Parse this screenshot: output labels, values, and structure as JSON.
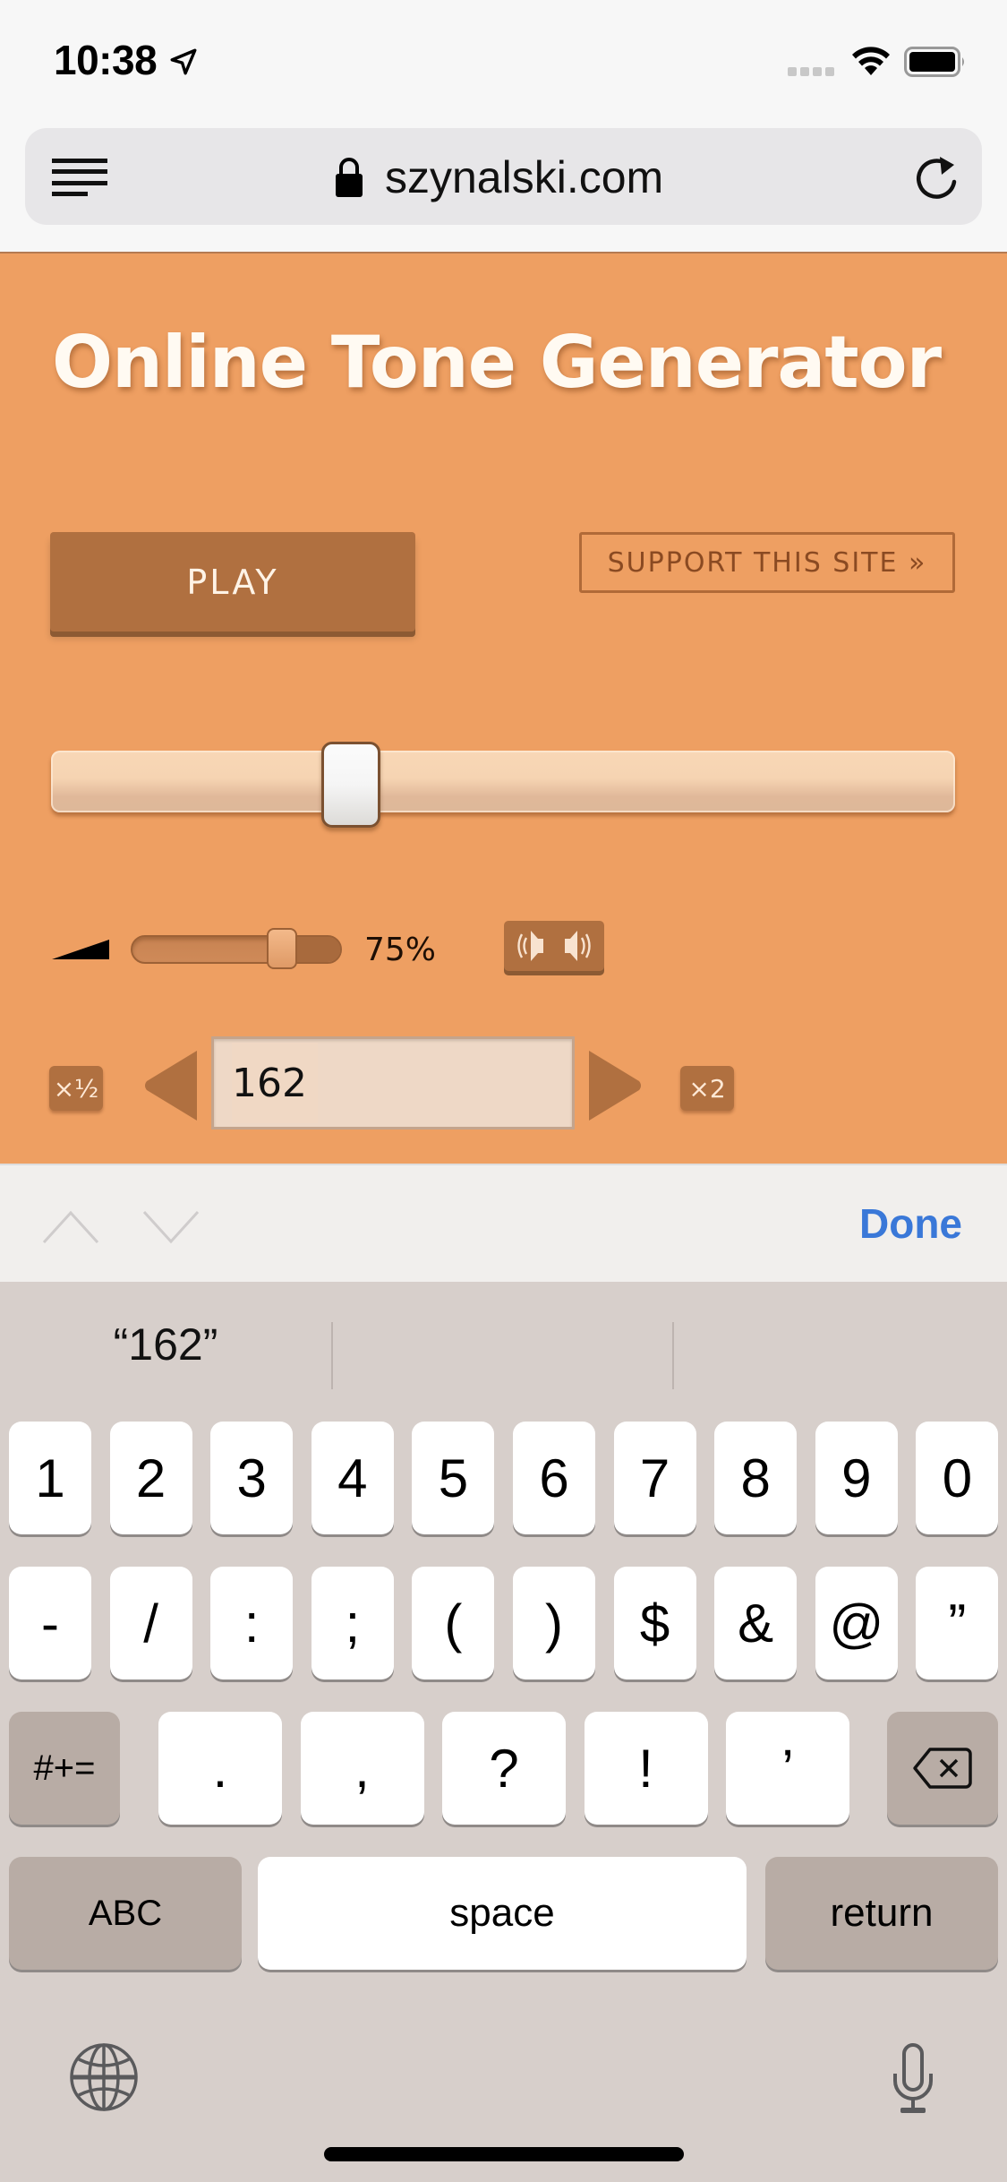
{
  "status_bar": {
    "time": "10:38",
    "icons": [
      "location-arrow-icon",
      "signal-icon",
      "wifi-icon",
      "battery-icon"
    ]
  },
  "browser": {
    "url": "szynalski.com",
    "icons": [
      "menu-icon",
      "lock-icon",
      "reload-icon"
    ]
  },
  "page": {
    "title": "Online Tone Generator",
    "play_label": "PLAY",
    "support_label": "SUPPORT THIS SITE »",
    "frequency_slider_position": 0.32,
    "volume": {
      "value": 0.75,
      "label": "75%"
    },
    "stereo_icon": "stereo-speakers-icon",
    "half_label": "×½",
    "double_label": "×2",
    "frequency_value": "162"
  },
  "keyboard_toolbar": {
    "done_label": "Done",
    "icons": [
      "chevron-up-icon",
      "chevron-down-icon"
    ]
  },
  "keyboard": {
    "suggestions": [
      "“162”",
      "",
      ""
    ],
    "row1": [
      "1",
      "2",
      "3",
      "4",
      "5",
      "6",
      "7",
      "8",
      "9",
      "0"
    ],
    "row2": [
      "-",
      "/",
      ":",
      ";",
      "(",
      ")",
      "$",
      "&",
      "@",
      "”"
    ],
    "row3": {
      "shift_label": "#+=",
      "keys": [
        ".",
        ",",
        "?",
        "!",
        "’"
      ],
      "delete_icon": "backspace-icon"
    },
    "row4": {
      "abc_label": "ABC",
      "space_label": "space",
      "return_label": "return"
    },
    "bottom_icons": [
      "globe-icon",
      "microphone-icon"
    ]
  }
}
